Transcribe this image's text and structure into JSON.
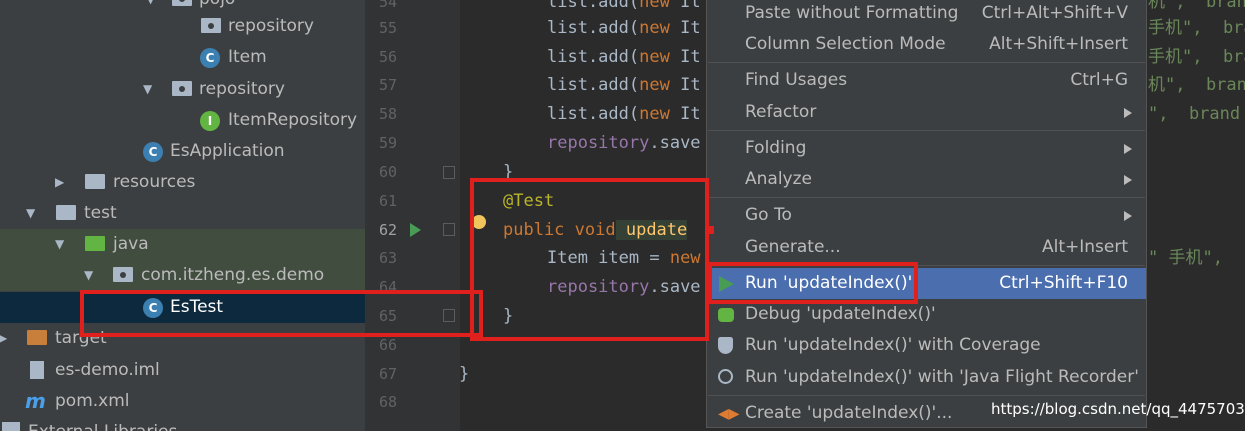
{
  "project_tree": [
    {
      "label": "pojo",
      "kind": "package"
    },
    {
      "label": "repository",
      "kind": "package"
    },
    {
      "label": "Item",
      "kind": "class"
    },
    {
      "label": "repository",
      "kind": "package"
    },
    {
      "label": "ItemRepository",
      "kind": "interface"
    },
    {
      "label": "EsApplication",
      "kind": "spring-class"
    },
    {
      "label": "resources",
      "kind": "folder"
    },
    {
      "label": "test",
      "kind": "folder"
    },
    {
      "label": "java",
      "kind": "test-source-folder"
    },
    {
      "label": "com.itzheng.es.demo",
      "kind": "package"
    },
    {
      "label": "EsTest",
      "kind": "spring-class"
    },
    {
      "label": "target",
      "kind": "excluded-folder"
    },
    {
      "label": "es-demo.iml",
      "kind": "file"
    },
    {
      "label": "pom.xml",
      "kind": "maven-file"
    },
    {
      "label": "External Libraries",
      "kind": "library"
    }
  ],
  "line_numbers": [
    "54",
    "55",
    "56",
    "57",
    "58",
    "59",
    "60",
    "61",
    "62",
    "63",
    "64",
    "65",
    "66",
    "67",
    "68"
  ],
  "code": {
    "l54_a": "list.add(",
    "l54_b": "new",
    "l54_c": " It",
    "l55_a": "list.add(",
    "l55_b": "new",
    "l55_c": " It",
    "l56_a": "list.add(",
    "l56_b": "new",
    "l56_c": " It",
    "l57_a": "list.add(",
    "l57_b": "new",
    "l57_c": " It",
    "l58_a": "list.add(",
    "l58_b": "new",
    "l58_c": " It",
    "l59_a": "repository",
    "l59_b": ".save",
    "l60": "}",
    "l61": "@Test",
    "l62_a": "public",
    "l62_b": " void",
    "l62_c": " update",
    "l63_a": "Item item = ",
    "l63_b": "new",
    "l64_a": "repository",
    "l64_b": ".save",
    "l65": "}",
    "l67": "}",
    "tail_55": "手机\",  bra",
    "tail_56": "手机\",  bra",
    "tail_57": "机\",  bran",
    "tail_58": "\",  brand",
    "tail_54": "机\",  bran",
    "tail_63": "\" 手机\","
  },
  "context_menu": {
    "items": [
      {
        "label": "Paste without Formatting",
        "shortcut": "Ctrl+Alt+Shift+V"
      },
      {
        "label": "Column Selection Mode",
        "shortcut": "Alt+Shift+Insert"
      },
      {
        "label": "Find Usages",
        "shortcut": "Ctrl+G"
      },
      {
        "label": "Refactor",
        "shortcut": ""
      },
      {
        "label": "Folding",
        "shortcut": ""
      },
      {
        "label": "Analyze",
        "shortcut": ""
      },
      {
        "label": "Go To",
        "shortcut": ""
      },
      {
        "label": "Generate...",
        "shortcut": "Alt+Insert"
      },
      {
        "label": "Run 'updateIndex()'",
        "shortcut": "Ctrl+Shift+F10"
      },
      {
        "label": "Debug 'updateIndex()'",
        "shortcut": ""
      },
      {
        "label": "Run 'updateIndex()' with Coverage",
        "shortcut": ""
      },
      {
        "label": "Run 'updateIndex()' with 'Java Flight Recorder'",
        "shortcut": ""
      },
      {
        "label": "Create 'updateIndex()'...",
        "shortcut": ""
      }
    ]
  },
  "watermark": "https://blog.csdn.net/qq_44757034",
  "colors": {
    "selection": "#4b6eaf",
    "annotation_box": "#e0201c"
  }
}
